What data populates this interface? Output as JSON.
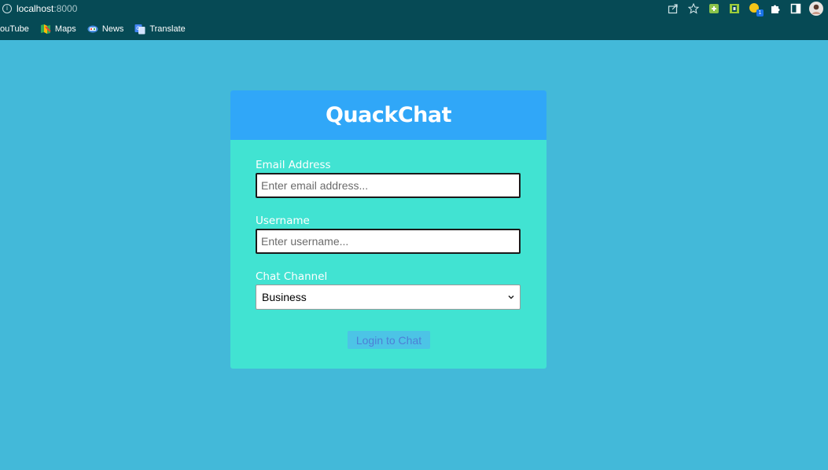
{
  "browser": {
    "url_host": "localhost",
    "url_port": ":8000",
    "bookmarks": [
      {
        "label": "ouTube",
        "icon": "youtube-icon"
      },
      {
        "label": "Maps",
        "icon": "maps-icon"
      },
      {
        "label": "News",
        "icon": "news-icon"
      },
      {
        "label": "Translate",
        "icon": "translate-icon"
      }
    ],
    "toolbar_icons": [
      "share-icon",
      "star-icon",
      "extension-green-icon",
      "extension-frame-icon",
      "extension-badge-icon",
      "puzzle-icon",
      "sidepanel-icon",
      "profile-avatar"
    ],
    "extension_badge_count": "1"
  },
  "login": {
    "title": "QuackChat",
    "email_label": "Email Address",
    "email_placeholder": "Enter email address...",
    "username_label": "Username",
    "username_placeholder": "Enter username...",
    "channel_label": "Chat Channel",
    "channel_selected": "Business",
    "submit_label": "Login to Chat"
  },
  "colors": {
    "page_background": "#43b9d9",
    "browser_chrome": "#064a55",
    "card_background": "#41e3d2",
    "card_header": "#30a7f8",
    "button_background": "#4cc4e6",
    "button_text": "#4d7fd6"
  }
}
